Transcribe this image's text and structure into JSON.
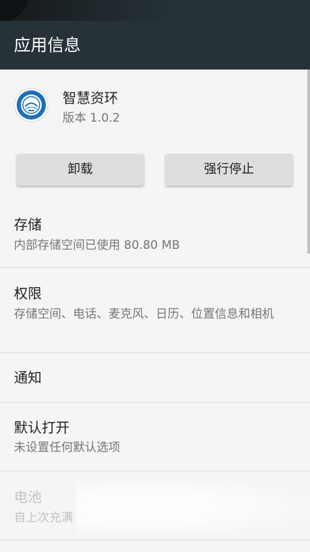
{
  "header": {
    "title": "应用信息"
  },
  "app": {
    "name": "智慧资环",
    "version": "版本 1.0.2",
    "icon": "university-logo-icon"
  },
  "buttons": {
    "uninstall": "卸载",
    "force_stop": "强行停止"
  },
  "rows": [
    {
      "title": "存储",
      "subtitle": "内部存储空间已使用 80.80 MB"
    },
    {
      "title": "权限",
      "subtitle": "存储空间、电话、麦克风、日历、位置信息和相机"
    },
    {
      "title": "通知"
    },
    {
      "title": "默认打开",
      "subtitle": "未设置任何默认选项"
    },
    {
      "title": "电池",
      "subtitle": "自上次充满"
    }
  ],
  "colors": {
    "toolbar": "#263238",
    "background": "#f5f5f5",
    "button": "#dedede"
  }
}
